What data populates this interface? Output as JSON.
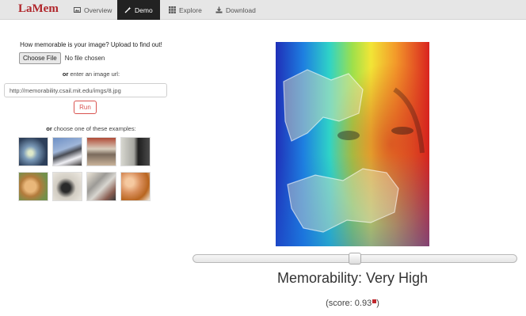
{
  "brand": "LaMem",
  "nav": [
    {
      "label": "Overview",
      "icon": "image-icon",
      "active": false
    },
    {
      "label": "Demo",
      "icon": "wand-icon",
      "active": true
    },
    {
      "label": "Explore",
      "icon": "grid-icon",
      "active": false
    },
    {
      "label": "Download",
      "icon": "download-icon",
      "active": false
    }
  ],
  "upload": {
    "prompt": "How memorable is your image? Upload to find out!",
    "choose_label": "Choose File",
    "no_file": "No file chosen",
    "or_word": "or",
    "url_hint": "enter an image url:",
    "url_value": "http://memorability.csail.mit.edu/imgs/8.jpg",
    "run_label": "Run",
    "examples_hint": "choose one of these examples:"
  },
  "result": {
    "title": "Memorability: Very High",
    "score_prefix": "(score: ",
    "score_value": "0.93",
    "score_suffix": ")",
    "slider_level": 0.5
  },
  "colors": {
    "brand": "#b0262b",
    "run_button": "#d9534f",
    "nav_active_bg": "#222222"
  }
}
